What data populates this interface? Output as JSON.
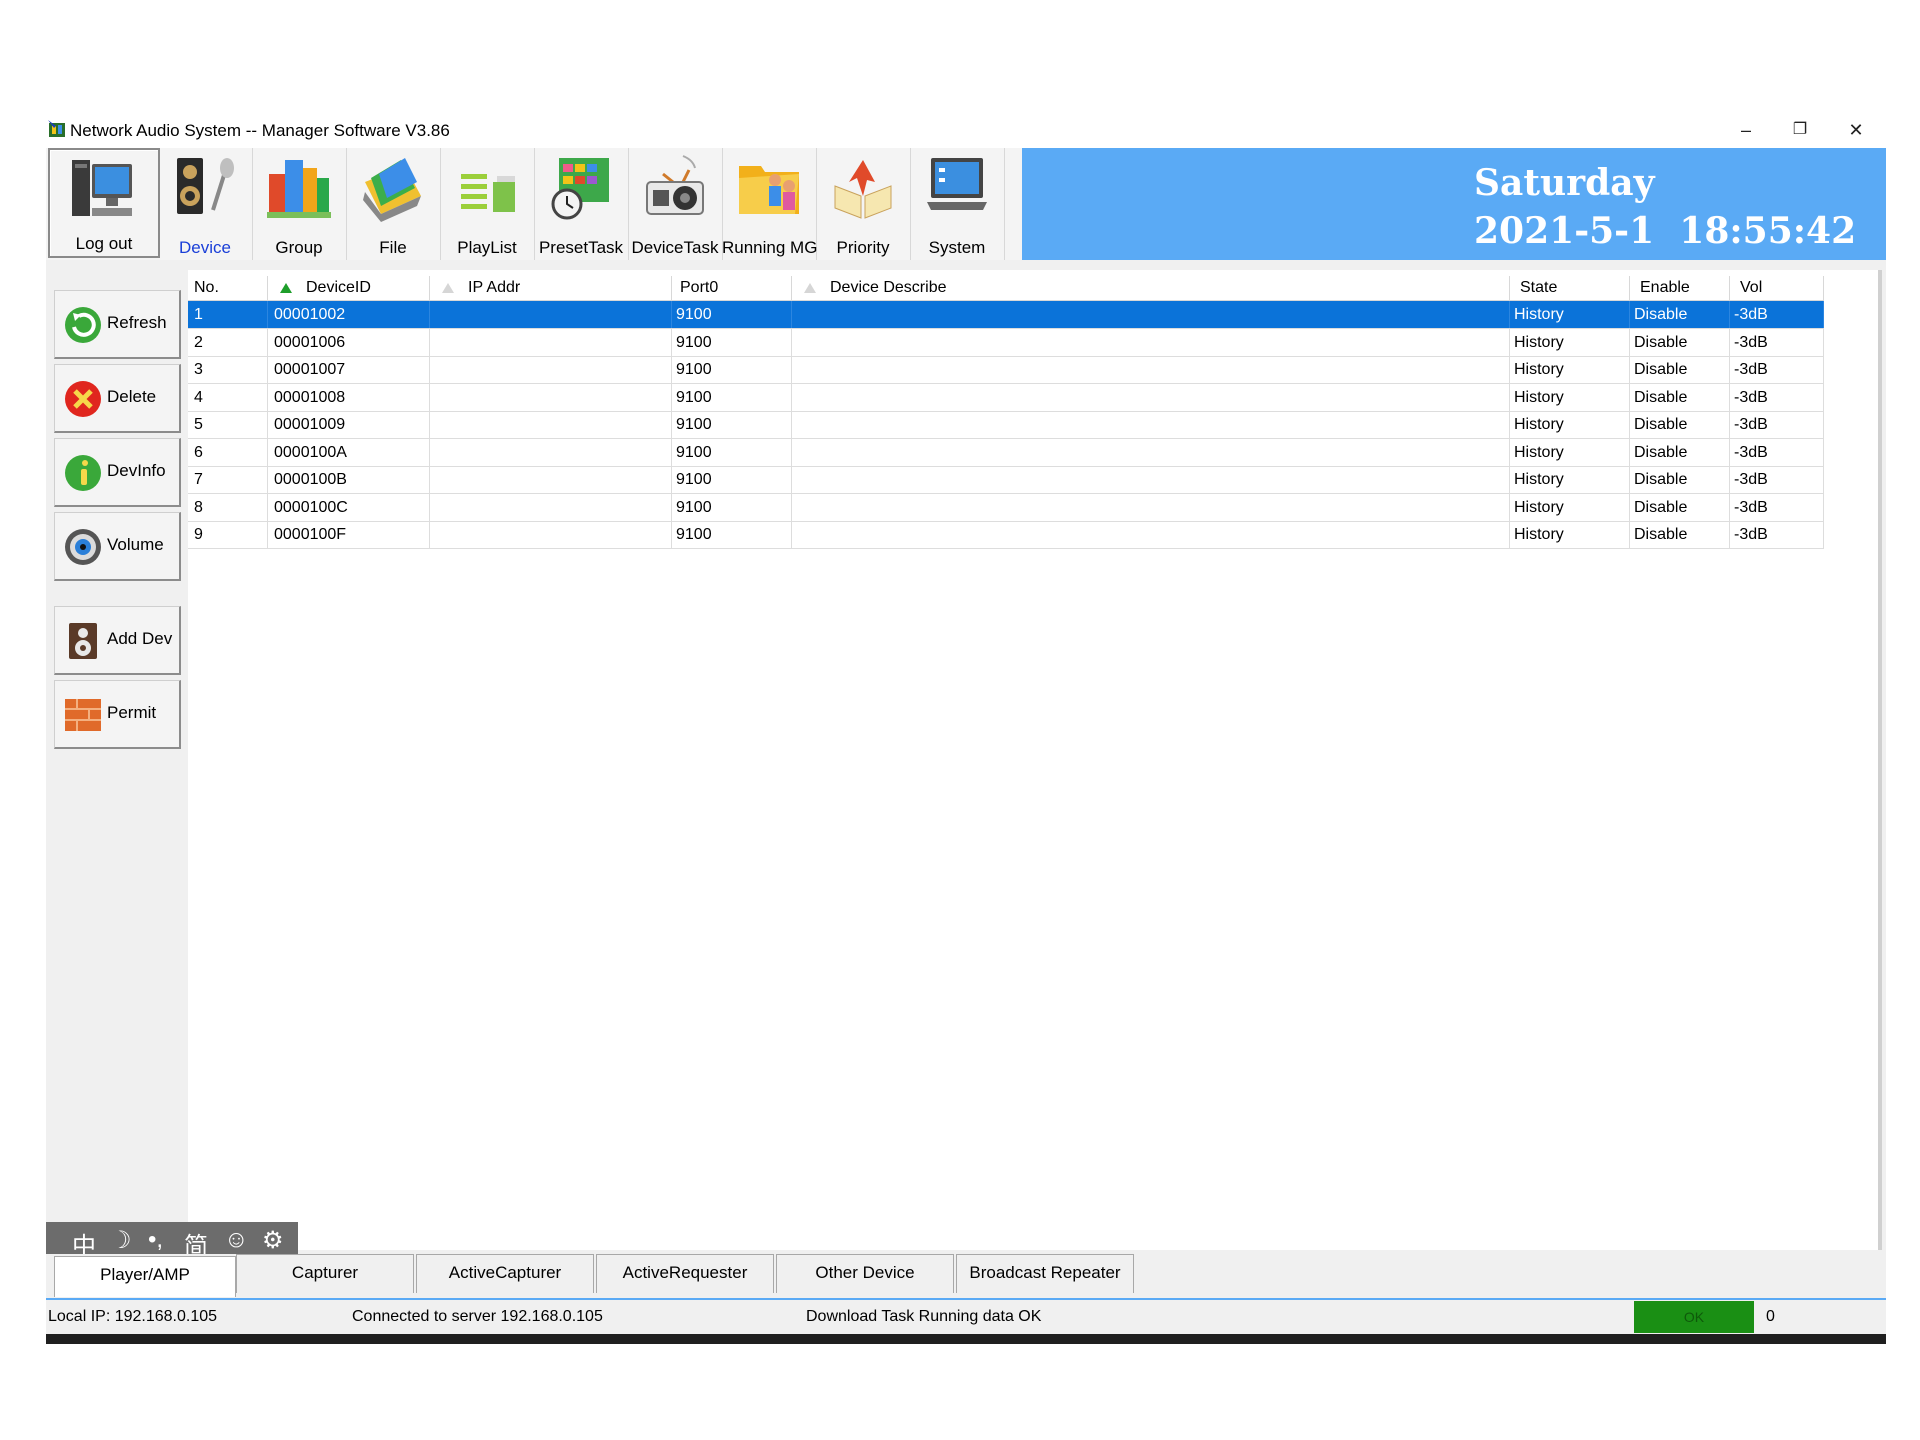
{
  "window": {
    "title": "Network Audio System -- Manager Software   V3.86",
    "controls": {
      "minimize": "–",
      "restore": "❐",
      "close": "✕"
    }
  },
  "toolbar": {
    "items": [
      {
        "label": "Log out",
        "icon": "computer-icon"
      },
      {
        "label": "Device",
        "icon": "speaker-mic-icon",
        "color": "#1a3fd8"
      },
      {
        "label": "Group",
        "icon": "buildings-icon"
      },
      {
        "label": "File",
        "icon": "folder-files-icon"
      },
      {
        "label": "PlayList",
        "icon": "playlist-icon"
      },
      {
        "label": "PresetTask",
        "icon": "calendar-clock-icon"
      },
      {
        "label": "DeviceTask",
        "icon": "radio-speaker-icon"
      },
      {
        "label": "Running MG",
        "icon": "folder-people-icon"
      },
      {
        "label": "Priority",
        "icon": "book-arrow-icon"
      },
      {
        "label": "System",
        "icon": "laptop-icon"
      }
    ]
  },
  "clock": {
    "day": "Saturday",
    "date": "2021-5-1",
    "time": "18:55:42",
    "bg": "#5aaaf5"
  },
  "sidebar": {
    "buttons": [
      {
        "label": "Refresh",
        "icon": "refresh-icon"
      },
      {
        "label": "Delete",
        "icon": "delete-icon"
      },
      {
        "label": "DevInfo",
        "icon": "info-icon"
      },
      {
        "label": "Volume",
        "icon": "volume-icon"
      },
      {
        "label": "Add Dev",
        "icon": "add-device-icon"
      },
      {
        "label": "Permit",
        "icon": "permit-icon"
      }
    ]
  },
  "table": {
    "columns": [
      "No.",
      "DeviceID",
      "IP Addr",
      "Port0",
      "Device Describe",
      "State",
      "Enable",
      "Vol"
    ],
    "rows": [
      [
        "1",
        "00001002",
        "",
        "9100",
        "",
        "History",
        "Disable",
        "-3dB"
      ],
      [
        "2",
        "00001006",
        "",
        "9100",
        "",
        "History",
        "Disable",
        "-3dB"
      ],
      [
        "3",
        "00001007",
        "",
        "9100",
        "",
        "History",
        "Disable",
        "-3dB"
      ],
      [
        "4",
        "00001008",
        "",
        "9100",
        "",
        "History",
        "Disable",
        "-3dB"
      ],
      [
        "5",
        "00001009",
        "",
        "9100",
        "",
        "History",
        "Disable",
        "-3dB"
      ],
      [
        "6",
        "0000100A",
        "",
        "9100",
        "",
        "History",
        "Disable",
        "-3dB"
      ],
      [
        "7",
        "0000100B",
        "",
        "9100",
        "",
        "History",
        "Disable",
        "-3dB"
      ],
      [
        "8",
        "0000100C",
        "",
        "9100",
        "",
        "History",
        "Disable",
        "-3dB"
      ],
      [
        "9",
        "0000100F",
        "",
        "9100",
        "",
        "History",
        "Disable",
        "-3dB"
      ]
    ],
    "selected_row": 0,
    "selection_color": "#0b73d9"
  },
  "ime": {
    "items": [
      "中",
      "☽",
      "•,",
      "简",
      "☺",
      "⚙"
    ]
  },
  "tabs": [
    "Player/AMP",
    "Capturer",
    "ActiveCapturer",
    "ActiveRequester",
    "Other Device",
    "Broadcast Repeater"
  ],
  "status": {
    "local_ip": "Local IP: 192.168.0.105",
    "connection": "Connected to server 192.168.0.105",
    "message": "Download Task Running data OK",
    "ok": "OK",
    "count": "0",
    "ok_color": "#1a8f14"
  }
}
